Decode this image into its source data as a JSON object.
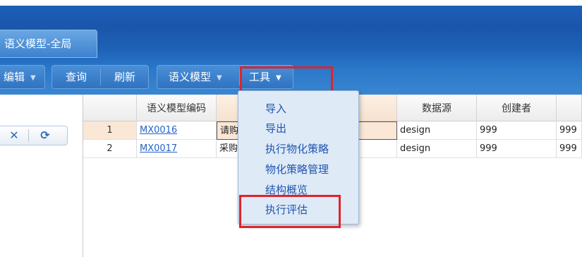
{
  "tabs": [
    {
      "label": "语义模型-全局",
      "active": true
    }
  ],
  "toolbar": {
    "edit_label": "编辑",
    "query_label": "查询",
    "refresh_label": "刷新",
    "semantic_model_label": "语义模型",
    "tools_label": "工具"
  },
  "left_panel": {
    "buttons": [
      {
        "icon": "close-icon",
        "glyph": "✕"
      },
      {
        "icon": "refresh-icon",
        "glyph": "⟳"
      }
    ]
  },
  "grid": {
    "columns": [
      "",
      "语义模型编码",
      "",
      "数据源",
      "创建者",
      ""
    ],
    "rows": [
      {
        "num": "1",
        "code": "MX0016",
        "name": "请购",
        "source": "design",
        "creator": "999",
        "extra": "999",
        "selected": true
      },
      {
        "num": "2",
        "code": "MX0017",
        "name": "采购",
        "source": "design",
        "creator": "999",
        "extra": "999",
        "selected": false
      }
    ]
  },
  "tools_menu": {
    "items": [
      "导入",
      "导出",
      "执行物化策略",
      "物化策略管理",
      "结构概览",
      "执行评估"
    ],
    "highlighted": "执行评估"
  },
  "colors": {
    "header": "#1d5fb8",
    "highlight": "#e0232c",
    "menu_bg": "#dfeaf7",
    "menu_text": "#1f56b0",
    "row_selected": "#fbe7d6"
  }
}
